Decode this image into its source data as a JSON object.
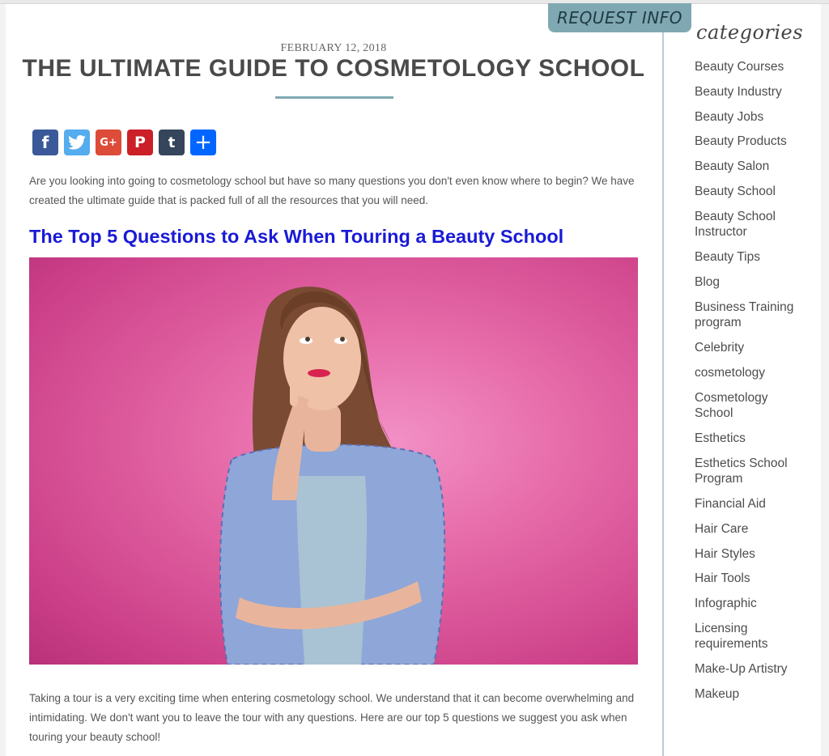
{
  "header": {
    "request_info_label": "REQUEST INFO"
  },
  "post": {
    "date": "FEBRUARY 12, 2018",
    "title": "THE ULTIMATE GUIDE TO COSMETOLOGY SCHOOL",
    "intro": "Are you looking into going to cosmetology school but have so many questions you don't even know where to begin? We have created the ultimate guide that is packed full of all the resources that you will need.",
    "section_heading": "The Top 5 Questions to Ask When Touring a Beauty School",
    "outro": "Taking a tour is a very exciting time when entering cosmetology school. We understand that it can become overwhelming and intimidating. We don't want you to leave the tour with any questions. Here are our top 5 questions we suggest you ask when touring your beauty school!"
  },
  "share": {
    "facebook_glyph": "f",
    "twitter_icon": "twitter-bird-icon",
    "googleplus_glyph": "G+",
    "pinterest_glyph": "P",
    "tumblr_glyph": "t",
    "add_glyph": "+"
  },
  "sidebar": {
    "title": "categories",
    "categories": [
      "Beauty Courses",
      "Beauty Industry",
      "Beauty Jobs",
      "Beauty Products",
      "Beauty Salon",
      "Beauty School",
      "Beauty School Instructor",
      "Beauty Tips",
      "Blog",
      "Business Training program",
      "Celebrity",
      "cosmetology",
      "Cosmetology School",
      "Esthetics",
      "Esthetics School Program",
      "Financial Aid",
      "Hair Care",
      "Hair Styles",
      "Hair Tools",
      "Infographic",
      "Licensing requirements",
      "Make-Up Artistry",
      "Makeup"
    ]
  },
  "colors": {
    "accent": "#7fa8b2",
    "link": "#1a1ad6",
    "hero_background": "#e66aa8"
  }
}
